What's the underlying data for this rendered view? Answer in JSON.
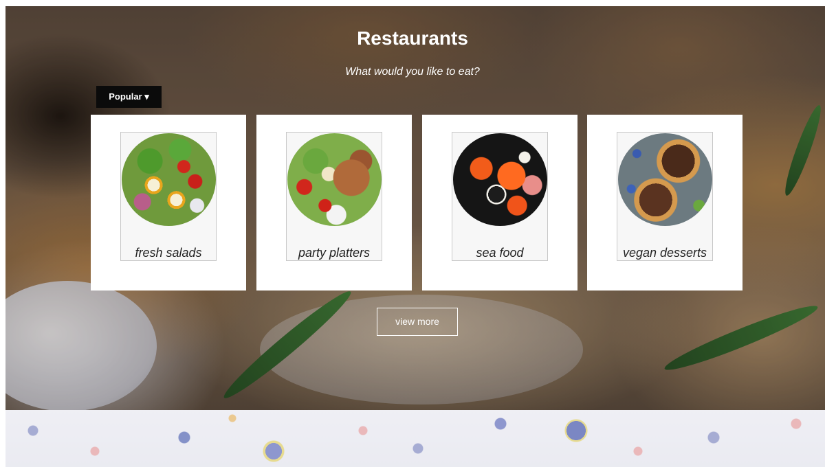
{
  "header": {
    "title": "Restaurants",
    "subtitle": "What would you like to eat?"
  },
  "filter": {
    "selected": "Popular ▾"
  },
  "categories": [
    {
      "label": "fresh salads",
      "icon": "salad-image"
    },
    {
      "label": "party platters",
      "icon": "platter-image"
    },
    {
      "label": "sea food",
      "icon": "sushi-image"
    },
    {
      "label": "vegan desserts",
      "icon": "tart-image"
    }
  ],
  "actions": {
    "view_more": "view more"
  },
  "colors": {
    "accent_dark": "#0b0b0b",
    "card_bg": "#ffffff",
    "text_light": "#ffffff",
    "label_text": "#222222"
  }
}
